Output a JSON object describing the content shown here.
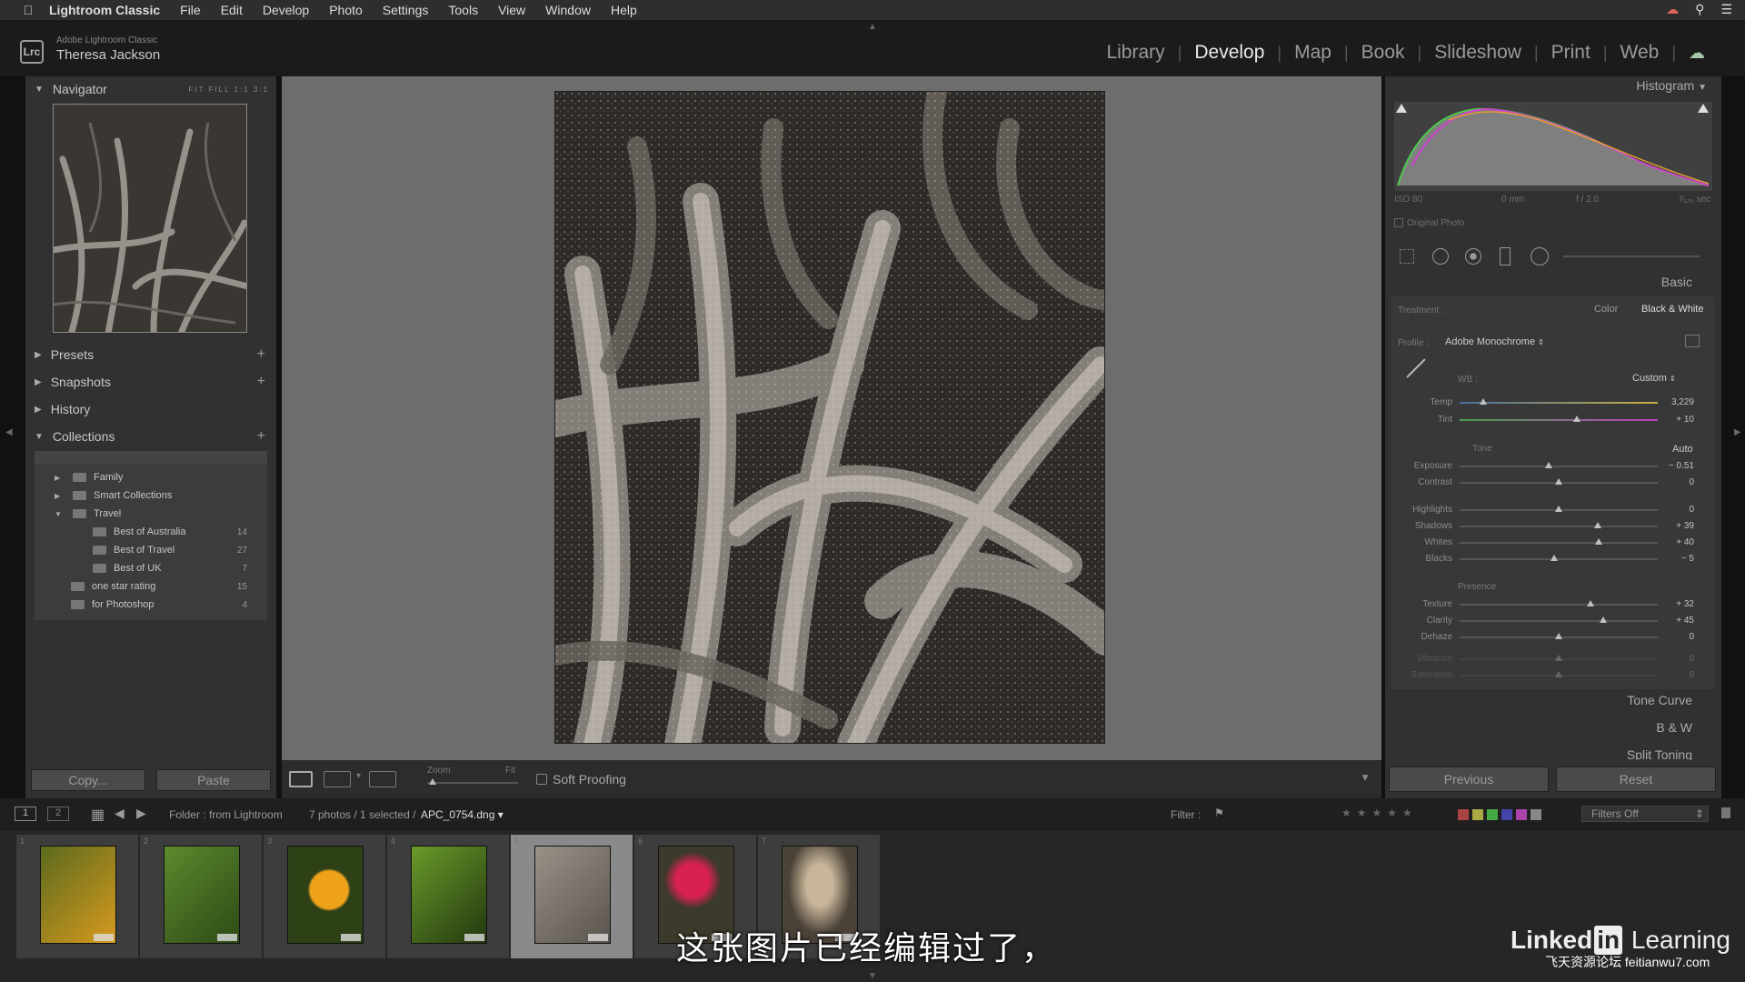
{
  "menubar": {
    "app": "Lightroom Classic",
    "items": [
      "File",
      "Edit",
      "Develop",
      "Photo",
      "Settings",
      "Tools",
      "View",
      "Window",
      "Help"
    ]
  },
  "identity": {
    "logo": "Lrc",
    "product": "Adobe Lightroom Classic",
    "user": "Theresa Jackson"
  },
  "modules": [
    "Library",
    "Develop",
    "Map",
    "Book",
    "Slideshow",
    "Print",
    "Web"
  ],
  "active_module": "Develop",
  "left": {
    "navigator": {
      "title": "Navigator",
      "zoom_options": [
        "FIT",
        "FILL",
        "1:1",
        "3:1"
      ]
    },
    "presets": "Presets",
    "snapshots": "Snapshots",
    "history": "History",
    "collections": {
      "title": "Collections",
      "items": [
        {
          "name": "Family",
          "count": ""
        },
        {
          "name": "Smart Collections",
          "count": ""
        },
        {
          "name": "Travel",
          "count": ""
        },
        {
          "name": "Best of Australia",
          "count": "14"
        },
        {
          "name": "Best of Travel",
          "count": "27"
        },
        {
          "name": "Best of UK",
          "count": "7"
        },
        {
          "name": "one star rating",
          "count": "15"
        },
        {
          "name": "for Photoshop",
          "count": "4"
        }
      ]
    },
    "copy": "Copy...",
    "paste": "Paste"
  },
  "toolbar": {
    "zoom_label": "Zoom",
    "fit_label": "Fit",
    "soft_proofing": "Soft Proofing"
  },
  "right": {
    "histogram": {
      "title": "Histogram",
      "meta": [
        "ISO 80",
        "0 mm",
        "f / 2.0",
        "¹⁄₁₂₅ sec"
      ],
      "original_photo": "Original Photo"
    },
    "basic": {
      "title": "Basic",
      "treatment_label": "Treatment :",
      "treatment_color": "Color",
      "treatment_bw": "Black & White",
      "profile_label": "Profile :",
      "profile_value": "Adobe Monochrome",
      "wb_label": "WB :",
      "wb_value": "Custom",
      "temp": {
        "label": "Temp",
        "value": "3,229"
      },
      "tint": {
        "label": "Tint",
        "value": "+ 10"
      },
      "tone_label": "Tone",
      "auto_label": "Auto",
      "exposure": {
        "label": "Exposure",
        "value": "− 0.51"
      },
      "contrast": {
        "label": "Contrast",
        "value": "0"
      },
      "highlights": {
        "label": "Highlights",
        "value": "0"
      },
      "shadows": {
        "label": "Shadows",
        "value": "+ 39"
      },
      "whites": {
        "label": "Whites",
        "value": "+ 40"
      },
      "blacks": {
        "label": "Blacks",
        "value": "− 5"
      },
      "presence_label": "Presence",
      "texture": {
        "label": "Texture",
        "value": "+ 32"
      },
      "clarity": {
        "label": "Clarity",
        "value": "+ 45"
      },
      "dehaze": {
        "label": "Dehaze",
        "value": "0"
      },
      "vibrance": {
        "label": "Vibrance",
        "value": "0"
      },
      "saturation": {
        "label": "Saturation",
        "value": "0"
      }
    },
    "tone_curve": "Tone Curve",
    "bw": "B & W",
    "split_toning": "Split Toning",
    "previous": "Previous",
    "reset": "Reset"
  },
  "filmstrip": {
    "view1": "1",
    "view2": "2",
    "source": "Folder : from Lightroom",
    "count_text": "7 photos / 1 selected /",
    "filename": "APC_0754.dng",
    "filter_label": "Filter :",
    "filters_off": "Filters Off",
    "thumbs": [
      {
        "num": "1",
        "colors": [
          "#5b6a1d",
          "#d79a1f"
        ],
        "kind": "fruit"
      },
      {
        "num": "2",
        "colors": [
          "#5d8a2e",
          "#2d4a16"
        ],
        "kind": "leaves"
      },
      {
        "num": "3",
        "colors": [
          "#eea21a",
          "#2d4016"
        ],
        "kind": "orange"
      },
      {
        "num": "4",
        "colors": [
          "#6a9a2a",
          "#22380f"
        ],
        "kind": "palm"
      },
      {
        "num": "5",
        "colors": [
          "#9a9288",
          "#5a544e"
        ],
        "kind": "fern",
        "selected": true
      },
      {
        "num": "6",
        "colors": [
          "#d9214f",
          "#3c3a2a"
        ],
        "kind": "flower"
      },
      {
        "num": "7",
        "colors": [
          "#c8b69a",
          "#4c4338"
        ],
        "kind": "dog"
      }
    ]
  },
  "subtitle": "这张图片已经编辑过了，",
  "brand": {
    "linked": "Linked",
    "in": "in",
    "learning": "Learning"
  },
  "watermark": "飞天资源论坛 feitianwu7.com"
}
